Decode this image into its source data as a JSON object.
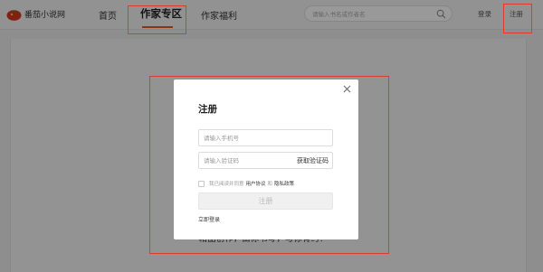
{
  "header": {
    "logo_text": "番茄小说网",
    "nav": {
      "home": "首页",
      "writer_zone": "作家专区",
      "writer_welfare": "作家福利"
    },
    "search_placeholder": "请输入书名或作者名",
    "login": "登录",
    "register": "注册"
  },
  "background": {
    "text_under_modal": "精品创作，由你书写，与你有约！"
  },
  "modal": {
    "title": "注册",
    "phone_placeholder": "请输入手机号",
    "code_placeholder": "请输入验证码",
    "get_code": "获取验证码",
    "agree_prefix": "我已阅读并同意",
    "user_agreement": "用户协议",
    "and": "和",
    "privacy_policy": "隐私政策",
    "submit": "注册",
    "login_now": "立即登录"
  },
  "colors": {
    "accent": "#e05a23",
    "highlight_box": "#e23a2a",
    "logo_tomato": "#d9381e"
  },
  "icons": [
    "tomato-logo-icon",
    "search-icon",
    "close-icon",
    "checkbox-icon"
  ]
}
